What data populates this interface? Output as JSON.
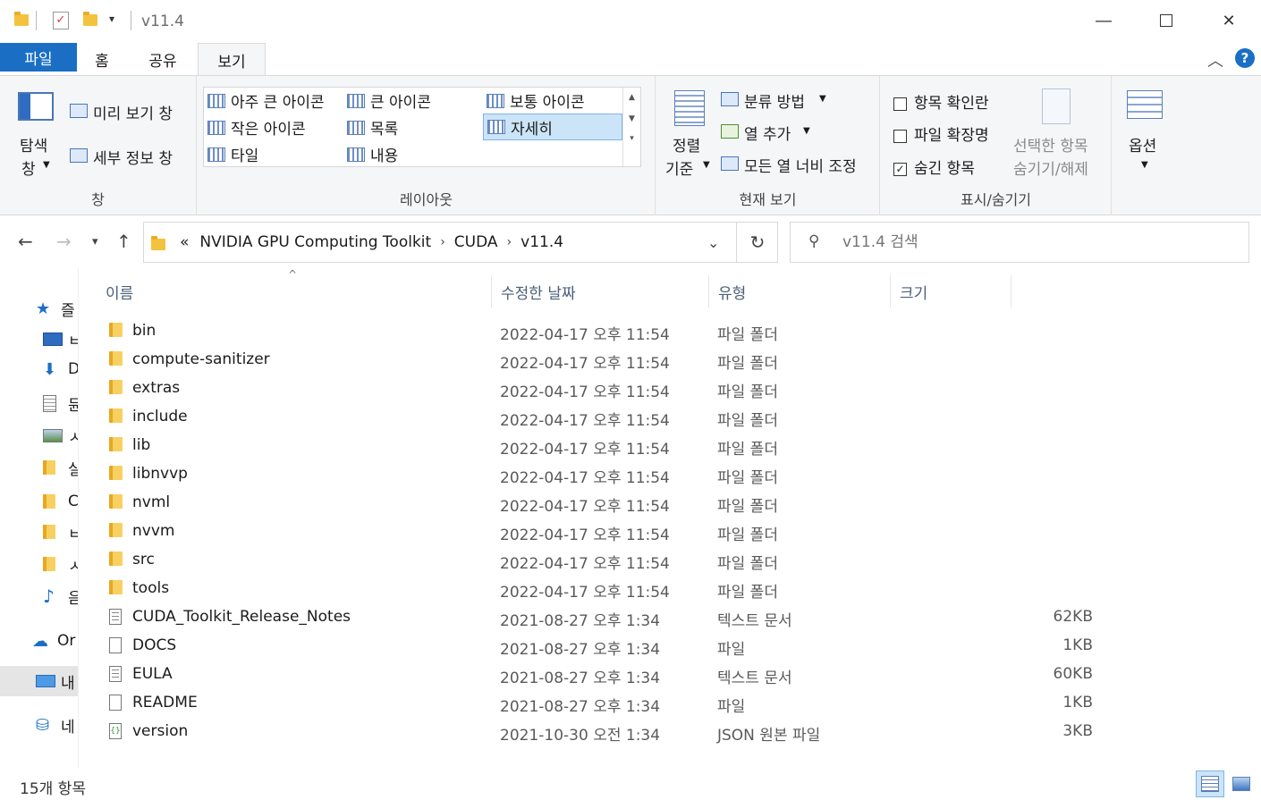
{
  "window": {
    "title": "v11.4"
  },
  "tabs": {
    "file": "파일",
    "home": "홈",
    "share": "공유",
    "view": "보기"
  },
  "ribbon": {
    "panes": {
      "nav_pane_line1": "탐색",
      "nav_pane_line2": "창",
      "preview_pane": "미리 보기 창",
      "details_pane": "세부 정보 창",
      "group_label": "창"
    },
    "layout": {
      "items": [
        "아주 큰 아이콘",
        "큰 아이콘",
        "보통 아이콘",
        "작은 아이콘",
        "목록",
        "자세히",
        "타일",
        "내용"
      ],
      "selected": "자세히",
      "group_label": "레이아웃"
    },
    "current_view": {
      "sort_line1": "정렬",
      "sort_line2": "기준",
      "group_by": "분류 방법",
      "add_columns": "열 추가",
      "size_columns": "모든 열 너비 조정",
      "group_label": "현재 보기"
    },
    "show_hide": {
      "item_checkboxes": "항목 확인란",
      "item_checkboxes_checked": false,
      "file_extensions": "파일 확장명",
      "file_extensions_checked": false,
      "hidden_items": "숨긴 항목",
      "hidden_items_checked": true,
      "hide_selected_line1": "선택한 항목",
      "hide_selected_line2": "숨기기/해제",
      "group_label": "표시/숨기기"
    },
    "options": {
      "label": "옵션"
    }
  },
  "address": {
    "overflow": "«",
    "crumbs": [
      "NVIDIA GPU Computing Toolkit",
      "CUDA",
      "v11.4"
    ]
  },
  "search": {
    "placeholder": "v11.4 검색"
  },
  "sidebar": {
    "items": [
      {
        "label": "즐",
        "icon": "star-icon"
      },
      {
        "label": "ㅂ",
        "icon": "desktop-icon"
      },
      {
        "label": "D",
        "icon": "download-icon"
      },
      {
        "label": "듄",
        "icon": "document-icon"
      },
      {
        "label": "ㅅ",
        "icon": "picture-icon"
      },
      {
        "label": "실",
        "icon": "folder-icon"
      },
      {
        "label": "C",
        "icon": "folder-icon"
      },
      {
        "label": "ㅂ",
        "icon": "folder-icon"
      },
      {
        "label": "ㅅ",
        "icon": "folder-icon"
      },
      {
        "label": "음",
        "icon": "music-icon"
      },
      {
        "label": "Or",
        "icon": "onedrive-icon"
      },
      {
        "label": "내",
        "icon": "pc-icon"
      },
      {
        "label": "네",
        "icon": "network-icon"
      }
    ]
  },
  "columns": {
    "name": "이름",
    "date": "수정한 날짜",
    "type": "유형",
    "size": "크기"
  },
  "files": [
    {
      "name": "bin",
      "date": "2022-04-17 오후 11:54",
      "type": "파일 폴더",
      "size": "",
      "kind": "folder"
    },
    {
      "name": "compute-sanitizer",
      "date": "2022-04-17 오후 11:54",
      "type": "파일 폴더",
      "size": "",
      "kind": "folder"
    },
    {
      "name": "extras",
      "date": "2022-04-17 오후 11:54",
      "type": "파일 폴더",
      "size": "",
      "kind": "folder"
    },
    {
      "name": "include",
      "date": "2022-04-17 오후 11:54",
      "type": "파일 폴더",
      "size": "",
      "kind": "folder"
    },
    {
      "name": "lib",
      "date": "2022-04-17 오후 11:54",
      "type": "파일 폴더",
      "size": "",
      "kind": "folder"
    },
    {
      "name": "libnvvp",
      "date": "2022-04-17 오후 11:54",
      "type": "파일 폴더",
      "size": "",
      "kind": "folder"
    },
    {
      "name": "nvml",
      "date": "2022-04-17 오후 11:54",
      "type": "파일 폴더",
      "size": "",
      "kind": "folder"
    },
    {
      "name": "nvvm",
      "date": "2022-04-17 오후 11:54",
      "type": "파일 폴더",
      "size": "",
      "kind": "folder"
    },
    {
      "name": "src",
      "date": "2022-04-17 오후 11:54",
      "type": "파일 폴더",
      "size": "",
      "kind": "folder"
    },
    {
      "name": "tools",
      "date": "2022-04-17 오후 11:54",
      "type": "파일 폴더",
      "size": "",
      "kind": "folder"
    },
    {
      "name": "CUDA_Toolkit_Release_Notes",
      "date": "2021-08-27 오후 1:34",
      "type": "텍스트 문서",
      "size": "62KB",
      "kind": "text"
    },
    {
      "name": "DOCS",
      "date": "2021-08-27 오후 1:34",
      "type": "파일",
      "size": "1KB",
      "kind": "file"
    },
    {
      "name": "EULA",
      "date": "2021-08-27 오후 1:34",
      "type": "텍스트 문서",
      "size": "60KB",
      "kind": "text"
    },
    {
      "name": "README",
      "date": "2021-08-27 오후 1:34",
      "type": "파일",
      "size": "1KB",
      "kind": "file"
    },
    {
      "name": "version",
      "date": "2021-10-30 오전 1:34",
      "type": "JSON 원본 파일",
      "size": "3KB",
      "kind": "json"
    }
  ],
  "status": {
    "item_count": "15개 항목"
  },
  "colors": {
    "accent": "#1a6fc4",
    "selection": "#cce4f7",
    "folder": "#f4c33d"
  }
}
